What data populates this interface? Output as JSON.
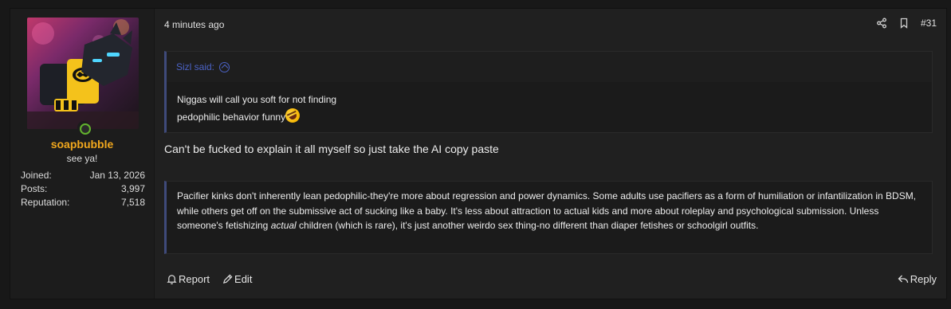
{
  "user": {
    "username": "soapbubble",
    "title": "see ya!",
    "stats": [
      {
        "label": "Joined:",
        "value": "Jan 13, 2026"
      },
      {
        "label": "Posts:",
        "value": "3,997"
      },
      {
        "label": "Reputation:",
        "value": "7,518"
      }
    ]
  },
  "post": {
    "timestamp": "4 minutes ago",
    "number": "#31",
    "quote": {
      "author_label": "Sizl said:",
      "line1": "Niggas will call you soft for not finding",
      "line2": "pedophilic behavior funny"
    },
    "message": "Can't be fucked to explain it all myself so just take the AI copy paste",
    "ai_quote": {
      "part1": "Pacifier kinks don't inherently lean pedophilic-they're more about regression and power dynamics. Some adults use pacifiers as a form of humiliation or infantilization in BDSM, while others get off on the submissive act of sucking like a baby. It's less about attraction to actual kids and more about roleplay and psychological submission. Unless someone's fetishizing ",
      "emphasis": "actual",
      "part2": " children (which is rare), it's just another weirdo sex thing-no different than diaper fetishes or schoolgirl outfits."
    },
    "actions": {
      "report": "Report",
      "edit": "Edit",
      "reply": "Reply"
    }
  },
  "colors": {
    "username": "#f2a81d",
    "quote_accent": "#4b62c4",
    "online": "#63b32e"
  }
}
